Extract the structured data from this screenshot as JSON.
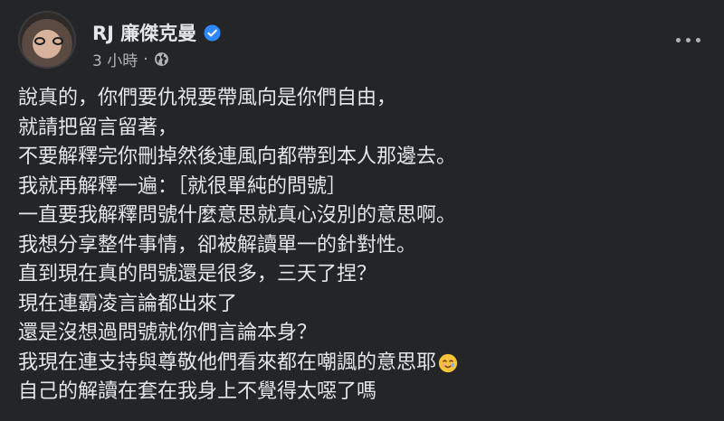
{
  "author": {
    "name": "RJ 廉傑克曼",
    "verified": true
  },
  "meta": {
    "time": "3 小時",
    "separator": "·",
    "audience_icon": "globe-icon"
  },
  "post": {
    "lines": [
      "說真的，你們要仇視要帶風向是你們自由，",
      "就請把留言留著，",
      "不要解釋完你刪掉然後連風向都帶到本人那邊去。",
      "我就再解釋一遍：［就很單純的問號］",
      "一直要我解釋問號什麼意思就真心沒別的意思啊。",
      "我想分享整件事情，卻被解讀單一的針對性。",
      "直到現在真的問號還是很多，三天了捏？",
      "現在連霸凌言論都出來了",
      "還是沒想過問號就你們言論本身？",
      "我現在連支持與尊敬他們看來都在嘲諷的意思耶",
      "自己的解讀在套在我身上不覺得太噁了嗎"
    ],
    "emoji_icon": "smiling-face-with-tear-emoji"
  },
  "colors": {
    "background": "#242526",
    "text": "#e4e6eb",
    "secondary": "#b0b3b8",
    "verified": "#2d88ff"
  }
}
